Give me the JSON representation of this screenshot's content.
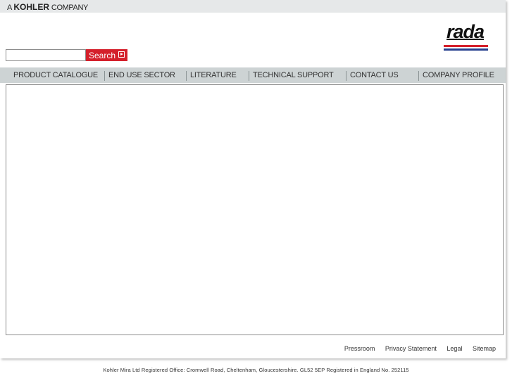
{
  "header": {
    "company_prefix": "A",
    "company_brand": "KOHLER",
    "company_suffix": "COMPANY",
    "logo_text": "rada"
  },
  "search": {
    "value": "",
    "placeholder": "",
    "button_label": "Search"
  },
  "nav": {
    "items": [
      {
        "label": "PRODUCT CATALOGUE"
      },
      {
        "label": "END USE SECTOR"
      },
      {
        "label": "LITERATURE"
      },
      {
        "label": "TECHNICAL SUPPORT"
      },
      {
        "label": "CONTACT US"
      },
      {
        "label": "COMPANY PROFILE"
      }
    ]
  },
  "footer": {
    "links": [
      {
        "label": "Pressroom"
      },
      {
        "label": "Privacy Statement"
      },
      {
        "label": "Legal"
      },
      {
        "label": "Sitemap"
      }
    ],
    "registered_text": "Kohler Mira Ltd Registered Office: Cromwell Road, Cheltenham, Gloucestershire. GL52 5EP Registered in England No. 252115"
  },
  "colors": {
    "accent_red": "#d4202b",
    "logo_blue": "#263f8e",
    "nav_background": "#cdd3d4",
    "topbar_background": "#e6e8e9"
  }
}
